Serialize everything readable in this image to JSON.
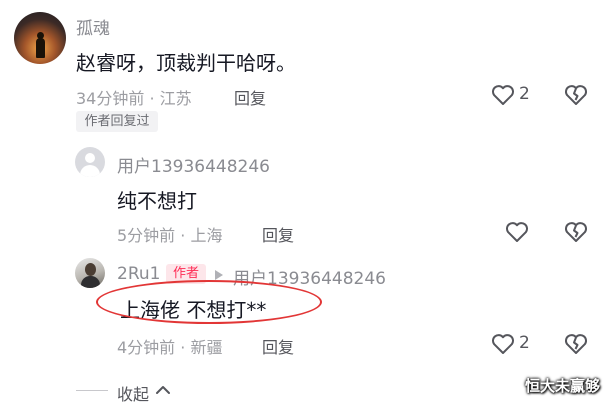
{
  "comment": {
    "username": "孤魂",
    "content": "赵睿呀，顶裁判干哈呀。",
    "meta": "34分钟前 · 江苏",
    "reply_label": "回复",
    "like_count": "2",
    "author_badge": "作者回复过"
  },
  "replies": [
    {
      "username": "用户13936448246",
      "content": "纯不想打",
      "meta": "5分钟前 · 上海",
      "reply_label": "回复"
    },
    {
      "username": "2Ru1",
      "author_tag": "作者",
      "reply_to": "用户13936448246",
      "content": "上海佬 不想打**",
      "meta": "4分钟前 · 新疆",
      "reply_label": "回复",
      "like_count": "2"
    }
  ],
  "collapse_label": "收起",
  "watermark": "恒大未赢够",
  "colors": {
    "author_tag": "#fe2c55",
    "annotation_oval": "#e23636"
  }
}
